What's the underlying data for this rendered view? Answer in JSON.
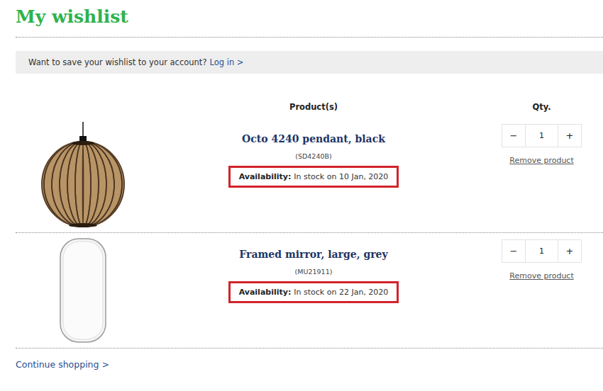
{
  "title": "My wishlist",
  "login_bar": {
    "text": "Want to save your wishlist to your account?",
    "link": "Log in >"
  },
  "columns": [
    "Product(s)",
    "Qty."
  ],
  "products": [
    {
      "kind": "pendant",
      "name": "Octo 4240 pendant, black",
      "code": "(SD4240B)",
      "availability_label": "Availability:",
      "availability": "In stock on 10 Jan, 2020",
      "highlighted": true,
      "minus": "−",
      "quantity": "1",
      "plus": "+",
      "remove": "Remove product"
    },
    {
      "kind": "mirror",
      "name": "Framed mirror, large, grey",
      "code": "(MU21911)",
      "availability_label": "Availability:",
      "availability": "In stock on 22 Jan, 2020",
      "highlighted": true,
      "minus": "−",
      "quantity": "1",
      "plus": "+",
      "remove": "Remove product"
    }
  ],
  "continue": "Continue shopping >"
}
